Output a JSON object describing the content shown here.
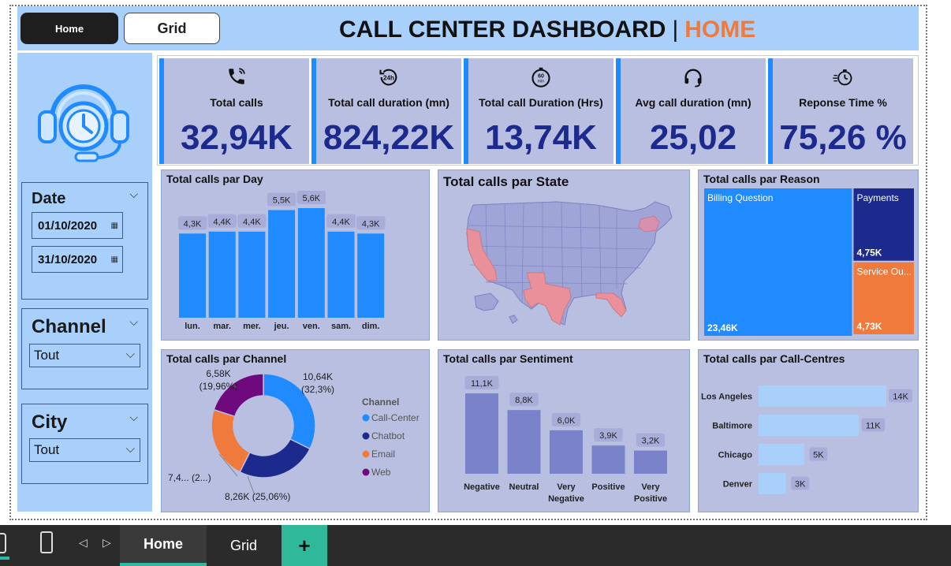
{
  "nav": {
    "home_label": "Home",
    "grid_label": "Grid"
  },
  "header": {
    "title_main": "CALL CENTER DASHBOARD",
    "separator": "|",
    "title_page": "HOME"
  },
  "filters": {
    "date": {
      "label": "Date",
      "start": "01/10/2020",
      "end": "31/10/2020"
    },
    "channel": {
      "label": "Channel",
      "value": "Tout"
    },
    "city": {
      "label": "City",
      "value": "Tout"
    }
  },
  "kpis": [
    {
      "label": "Total calls",
      "value": "32,94K",
      "icon": "phone-icon"
    },
    {
      "label": "Total call duration (mn)",
      "value": "824,22K",
      "icon": "24h-clock-icon"
    },
    {
      "label": "Total call Duration (Hrs)",
      "value": "13,74K",
      "icon": "60min-timer-icon"
    },
    {
      "label": "Avg call duration (mn)",
      "value": "25,02",
      "icon": "headset-icon"
    },
    {
      "label": "Reponse Time %",
      "value": "75,26 %",
      "icon": "stopwatch-icon"
    }
  ],
  "colors": {
    "accent_blue": "#1f8bff",
    "navy": "#1b2a8c",
    "orange": "#f07a3c",
    "purple": "#6e0a7e",
    "panel_bg": "#b9bfe0",
    "sidebar_bg": "#a8d0fb",
    "sentiment_bar": "#7a83c9",
    "callcentre_bar": "#a8d0fb"
  },
  "chart_data": [
    {
      "id": "calls-by-day",
      "type": "bar",
      "title": "Total calls par Day",
      "categories": [
        "lun.",
        "mar.",
        "mer.",
        "jeu.",
        "ven.",
        "sam.",
        "dim."
      ],
      "values": [
        4.3,
        4.4,
        4.4,
        5.5,
        5.6,
        4.4,
        4.3
      ],
      "labels": [
        "4,3K",
        "4,4K",
        "4,4K",
        "5,5K",
        "5,6K",
        "4,4K",
        "4,3K"
      ],
      "ylim": [
        0,
        6
      ]
    },
    {
      "id": "calls-by-state",
      "type": "map",
      "title": "Total calls par State",
      "highlighted_states": [
        "California",
        "Texas",
        "Florida",
        "New York"
      ]
    },
    {
      "id": "calls-by-reason",
      "type": "treemap",
      "title": "Total calls par Reason",
      "items": [
        {
          "name": "Billing Question",
          "value": 23.46,
          "label": "23,46K",
          "color": "#1f8bff"
        },
        {
          "name": "Payments",
          "value": 4.75,
          "label": "4,75K",
          "color": "#1b2a8c"
        },
        {
          "name": "Service Ou...",
          "value": 4.73,
          "label": "4,73K",
          "color": "#f07a3c"
        }
      ]
    },
    {
      "id": "calls-by-channel",
      "type": "pie",
      "title": "Total calls par Channel",
      "legend_title": "Channel",
      "slices": [
        {
          "name": "Call-Center",
          "value": 10.64,
          "label_line1": "10,64K",
          "label_line2": "(32,3%)",
          "color": "#1f8bff"
        },
        {
          "name": "Chatbot",
          "value": 8.26,
          "label_line1": "8,26K (25,06%)",
          "label_line2": "",
          "color": "#1b2a8c"
        },
        {
          "name": "Email",
          "value": 7.4,
          "label_line1": "7,4... (2...)",
          "label_line2": "",
          "color": "#f07a3c"
        },
        {
          "name": "Web",
          "value": 6.58,
          "label_line1": "6,58K",
          "label_line2": "(19,96%)",
          "color": "#6e0a7e"
        }
      ]
    },
    {
      "id": "calls-by-sentiment",
      "type": "bar",
      "title": "Total calls par Sentiment",
      "categories": [
        [
          "Negative"
        ],
        [
          "Neutral"
        ],
        [
          "Very",
          "Negative"
        ],
        [
          "Positive"
        ],
        [
          "Very",
          "Positive"
        ]
      ],
      "values": [
        11.1,
        8.8,
        6.0,
        3.9,
        3.2
      ],
      "labels": [
        "11,1K",
        "8,8K",
        "6,0K",
        "3,9K",
        "3,2K"
      ],
      "ylim": [
        0,
        12
      ]
    },
    {
      "id": "calls-by-callcentre",
      "type": "bar",
      "orientation": "horizontal",
      "title": "Total calls par Call-Centres",
      "categories": [
        "Los Angeles",
        "Baltimore",
        "Chicago",
        "Denver"
      ],
      "values": [
        14,
        11,
        5,
        3
      ],
      "labels": [
        "14K",
        "11K",
        "5K",
        "3K"
      ],
      "xlim": [
        0,
        14
      ]
    }
  ],
  "taskbar": {
    "home_tab": "Home",
    "grid_tab": "Grid",
    "add_label": "+"
  }
}
